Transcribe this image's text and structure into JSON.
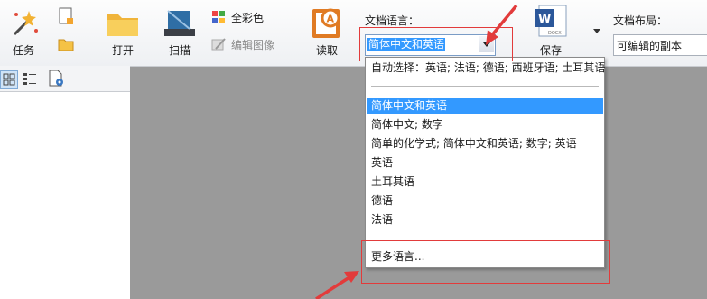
{
  "toolbar": {
    "task_label": "任务",
    "open_label": "打开",
    "scan_label": "扫描",
    "full_color_label": "全彩色",
    "edit_image_label": "编辑图像",
    "read_label": "读取",
    "doc_language_label": "文档语言：",
    "doc_language_value": "简体中文和英语",
    "save_label": "保存",
    "docx_icon_text": "DOCX",
    "doc_layout_label": "文档布局：",
    "doc_layout_value": "可编辑的副本"
  },
  "language_dropdown": {
    "auto_select": "自动选择：英语; 法语; 德语; 西班牙语; 土耳其语",
    "options": [
      "简体中文和英语",
      "简体中文; 数字",
      "简单的化学式; 简体中文和英语; 数字; 英语",
      "英语",
      "土耳其语",
      "德语",
      "法语"
    ],
    "selected_index": 0,
    "more_languages": "更多语言..."
  },
  "colors": {
    "selection": "#3399ff",
    "annotation_red": "#e23b3b",
    "workspace_gray": "#9a9a9a"
  }
}
